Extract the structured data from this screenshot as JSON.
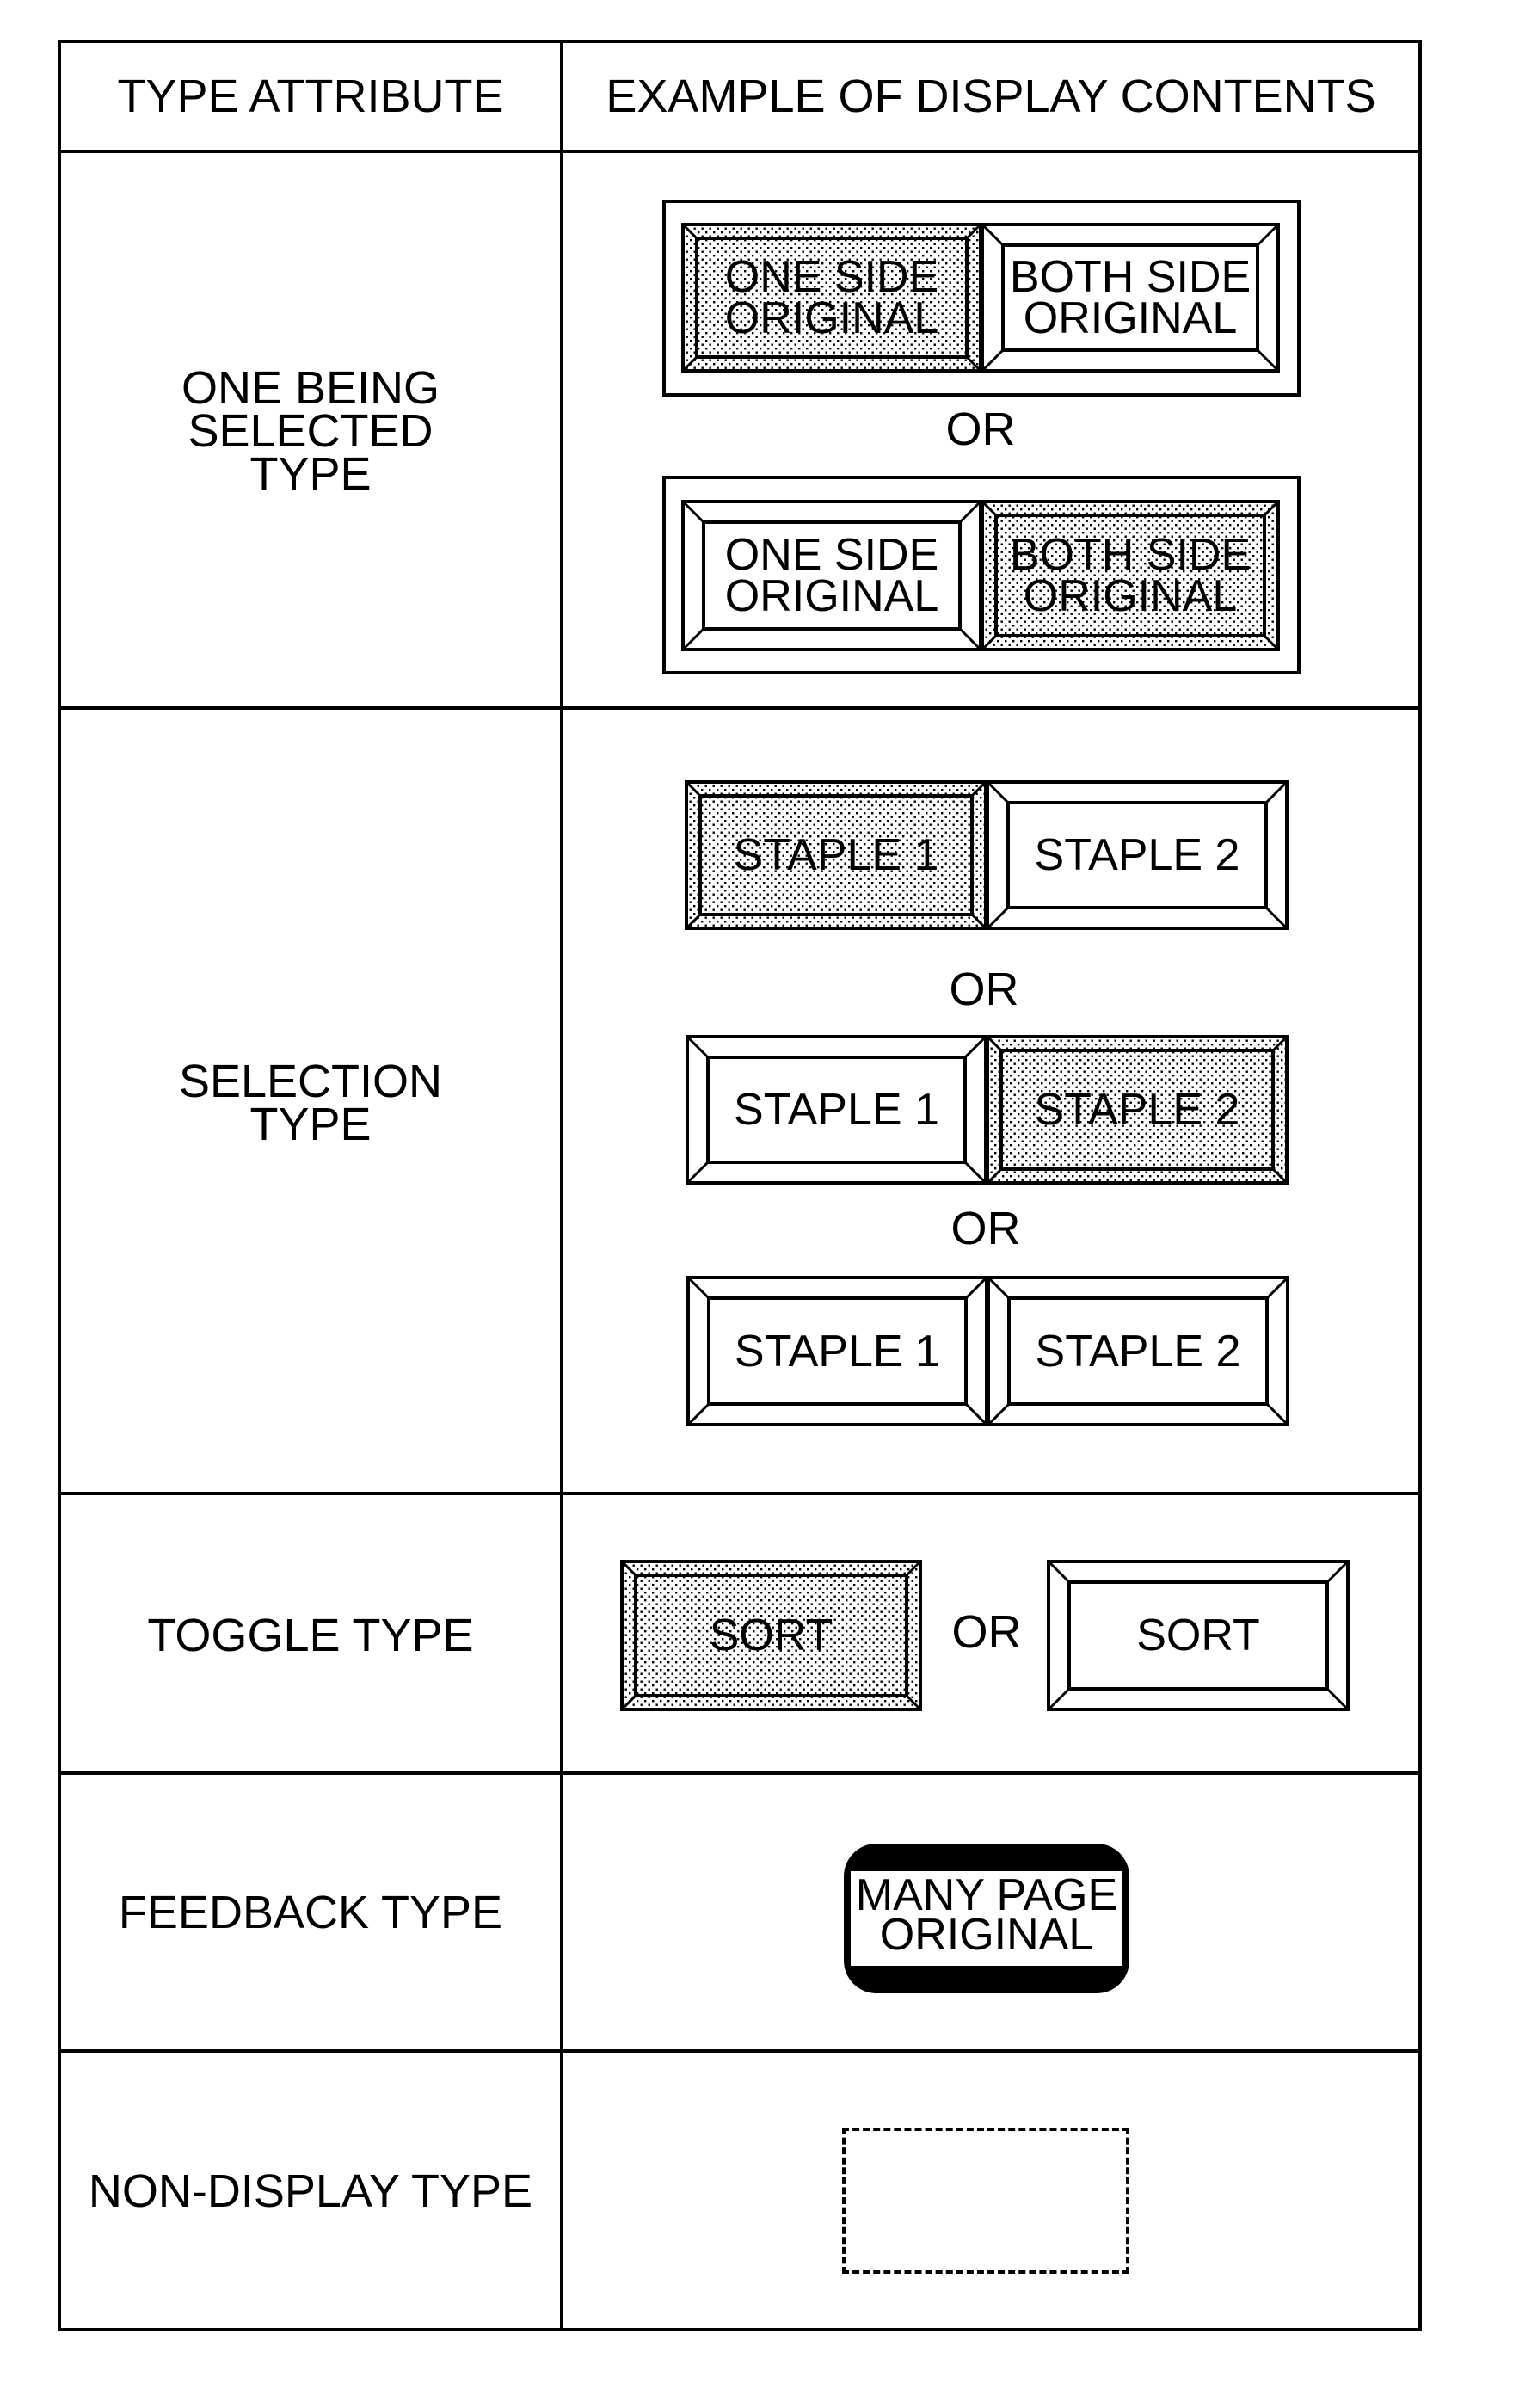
{
  "table": {
    "headers": {
      "type_attribute": "TYPE ATTRIBUTE",
      "example": "EXAMPLE OF DISPLAY CONTENTS"
    },
    "rows": [
      {
        "type": "ONE BEING\nSELECTED\nTYPE",
        "examples": [
          {
            "buttons": [
              {
                "label": "ONE SIDE\nORIGINAL",
                "selected": true
              },
              {
                "label": "BOTH SIDE\nORIGINAL",
                "selected": false
              }
            ]
          },
          {
            "buttons": [
              {
                "label": "ONE SIDE\nORIGINAL",
                "selected": false
              },
              {
                "label": "BOTH SIDE\nORIGINAL",
                "selected": true
              }
            ]
          }
        ],
        "separator": "OR"
      },
      {
        "type": "SELECTION\nTYPE",
        "examples": [
          {
            "buttons": [
              {
                "label": "STAPLE 1",
                "selected": true
              },
              {
                "label": "STAPLE 2",
                "selected": false
              }
            ]
          },
          {
            "buttons": [
              {
                "label": "STAPLE 1",
                "selected": false
              },
              {
                "label": "STAPLE 2",
                "selected": true
              }
            ]
          },
          {
            "buttons": [
              {
                "label": "STAPLE 1",
                "selected": false
              },
              {
                "label": "STAPLE 2",
                "selected": false
              }
            ]
          }
        ],
        "separator": "OR"
      },
      {
        "type": "TOGGLE TYPE",
        "examples": [
          {
            "label": "SORT",
            "selected": true
          },
          {
            "label": "SORT",
            "selected": false
          }
        ],
        "separator": "OR"
      },
      {
        "type": "FEEDBACK TYPE",
        "example": {
          "label": "MANY PAGE\nORIGINAL"
        }
      },
      {
        "type": "NON-DISPLAY TYPE",
        "example": {
          "label": ""
        }
      }
    ]
  },
  "colors": {
    "line": "#000000",
    "background": "#ffffff",
    "selected_fill_pattern": "dotted-gray"
  }
}
